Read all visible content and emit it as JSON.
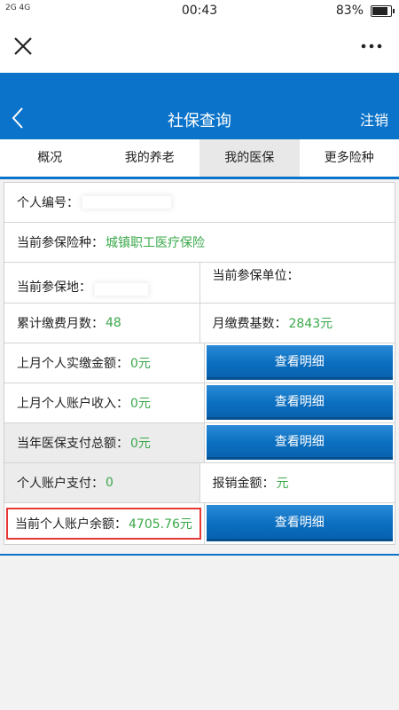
{
  "status": {
    "signal": "2G 4G",
    "time": "00:43",
    "battery": "83%"
  },
  "header": {
    "title": "社保查询",
    "logout": "注销"
  },
  "tabs": [
    "概况",
    "我的养老",
    "我的医保",
    "更多险种"
  ],
  "active_tab": 2,
  "fields": {
    "id_label": "个人编号：",
    "insurance_type_label": "当前参保险种：",
    "insurance_type_value": "城镇职工医疗保险",
    "location_label": "当前参保地：",
    "unit_label": "当前参保单位：",
    "months_label": "累计缴费月数：",
    "months_value": "48",
    "base_label": "月缴费基数：",
    "base_value": "2843元",
    "last_month_paid_label": "上月个人实缴金额：",
    "last_month_paid_value": "0元",
    "last_month_income_label": "上月个人账户收入：",
    "last_month_income_value": "0元",
    "year_total_label": "当年医保支付总额：",
    "year_total_value": "0元",
    "account_pay_label": "个人账户支付：",
    "account_pay_value": "0",
    "reimburse_label": "报销金额：",
    "reimburse_value": "元",
    "balance_label": "当前个人账户余额：",
    "balance_value": "4705.76元"
  },
  "button_label": "查看明细",
  "colors": {
    "brand_blue": "#0b73c9",
    "value_green": "#3aa84a",
    "highlight_red": "#e53935"
  }
}
